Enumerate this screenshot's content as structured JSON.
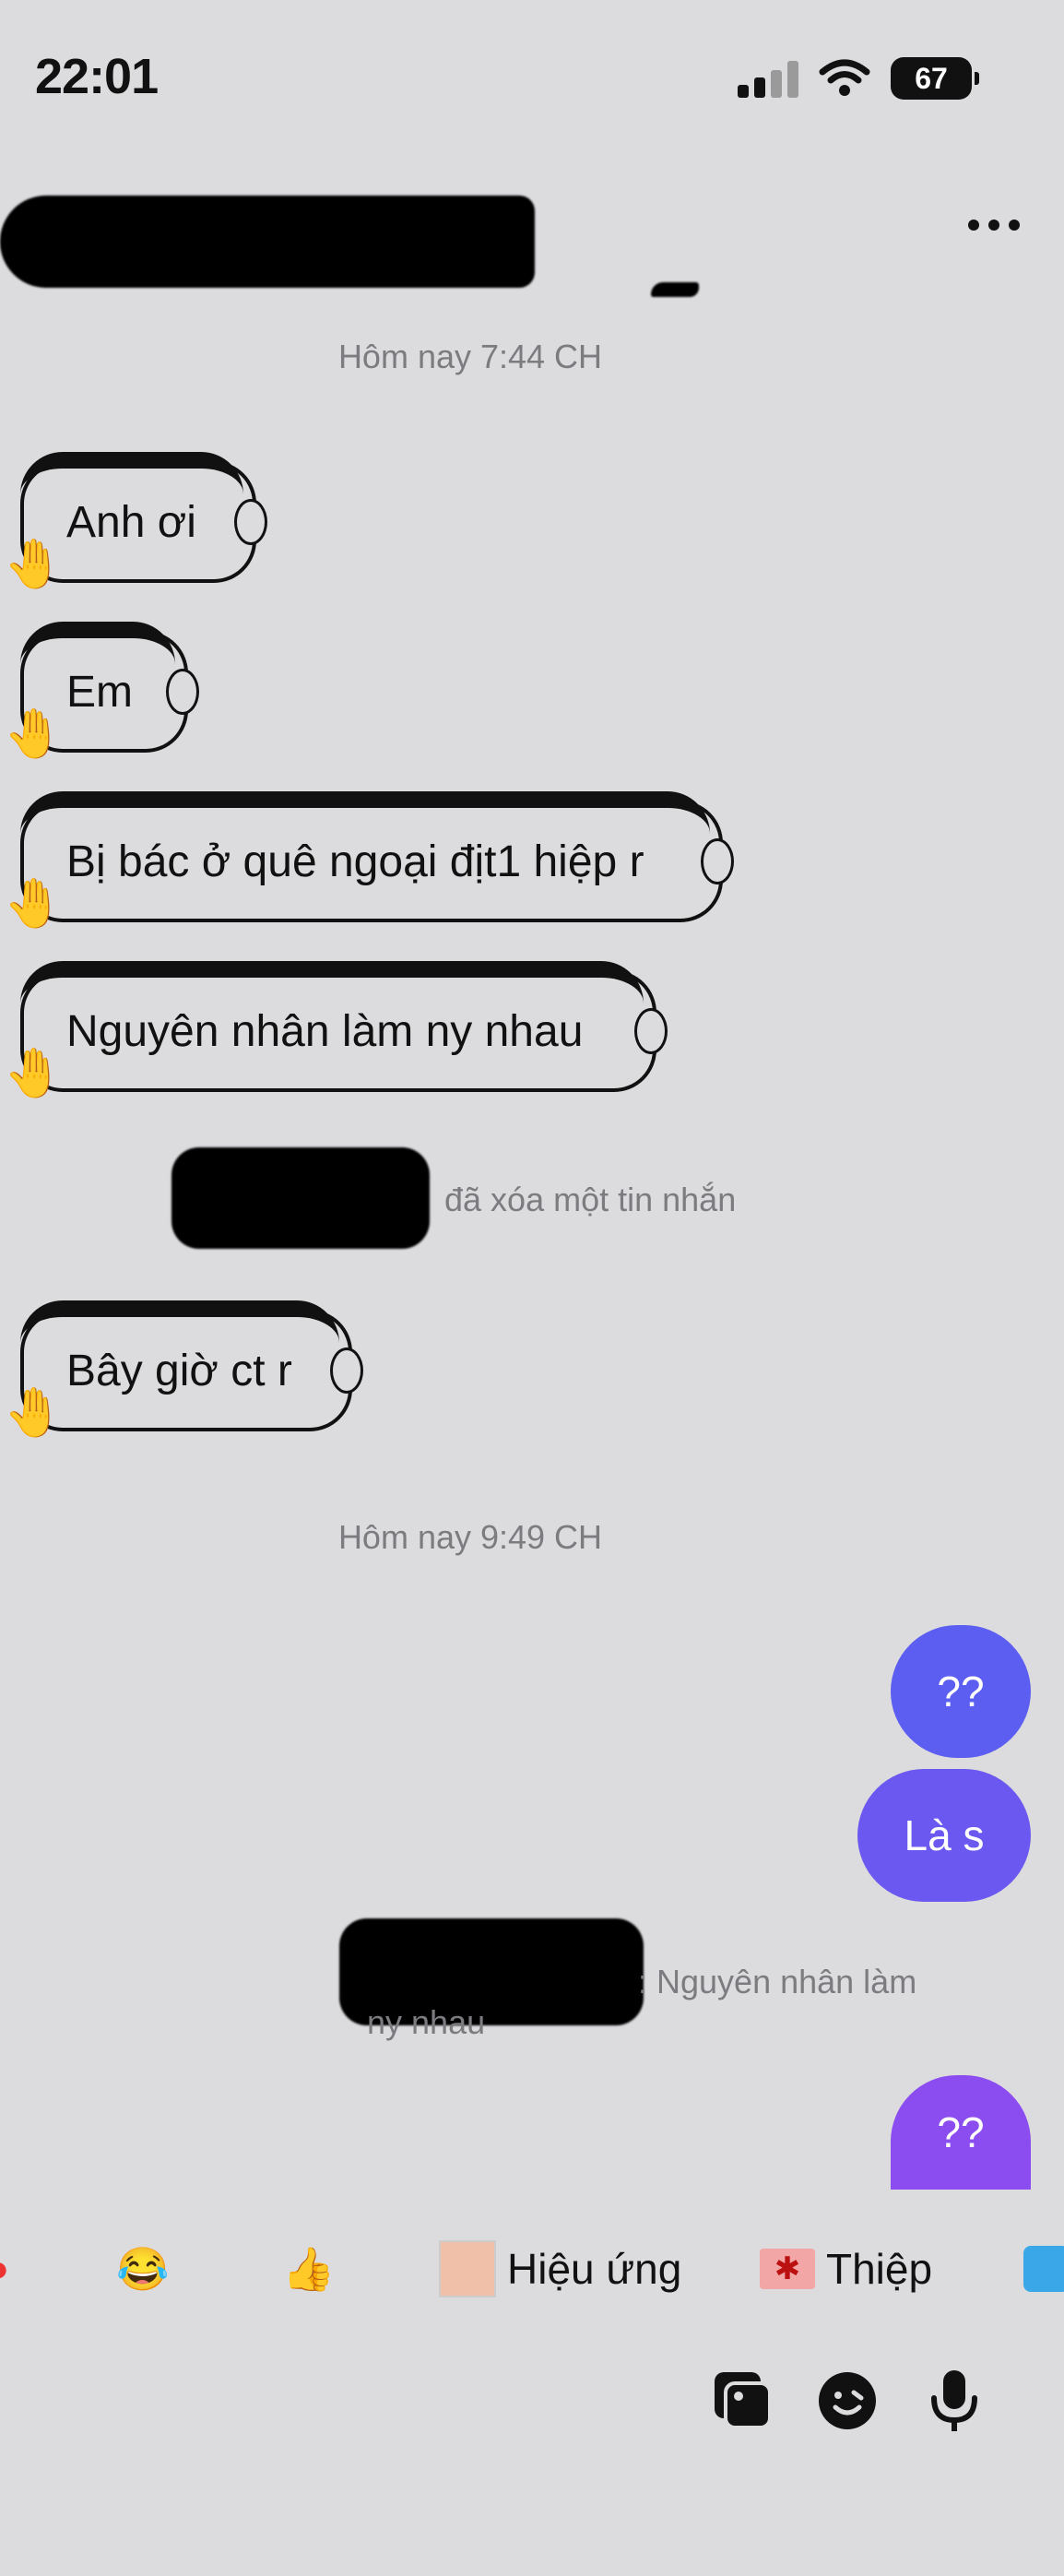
{
  "status_bar": {
    "time": "22:01",
    "battery": "67"
  },
  "header": {
    "more_label": "⋯"
  },
  "messages": {
    "timestamp_1": "Hôm nay 7:44 CH",
    "incoming_1": "Anh ơi",
    "incoming_2": "Em",
    "incoming_3": "Bị bác ở quê ngoại địt1 hiệp r",
    "incoming_4": "Nguyên nhân làm ny nhau",
    "deleted_notice": "đã xóa một tin nhắn",
    "incoming_5": "Bây giờ ct r",
    "timestamp_2": "Hôm nay 9:49 CH",
    "outgoing_1": "??",
    "outgoing_2": "Là s",
    "reply_quote_line1": ": Nguyên nhân làm",
    "reply_quote_line2": "ny nhau",
    "outgoing_3": "??"
  },
  "suggestions": {
    "emoji_1": "😂",
    "emoji_2": "👍",
    "effects_label": "Hiệu ứng",
    "card_label": "Thiệp"
  },
  "colors": {
    "background": "#dcdcdf",
    "outgoing_blue": "#5b5ef0",
    "outgoing_purple": "#8b4cf0",
    "muted_text": "#7c7c80"
  },
  "icons": [
    "signal-icon",
    "wifi-icon",
    "battery-icon",
    "more-icon",
    "hand-icon",
    "gallery-icon",
    "sticker-icon",
    "microphone-icon"
  ]
}
